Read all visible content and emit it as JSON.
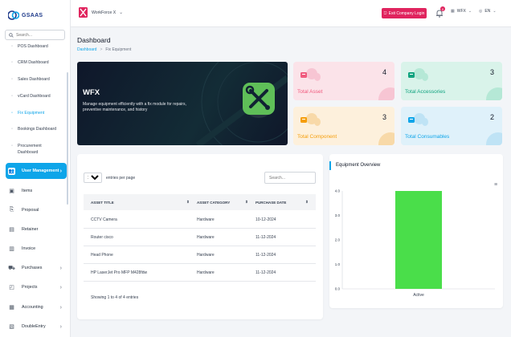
{
  "brand": {
    "name": "GSAAS",
    "accent": "#0ea5e9",
    "danger": "#e0245e"
  },
  "sidebar": {
    "search_placeholder": "Search...",
    "sub_items": [
      "POS Dashboard",
      "CRM Dashboard",
      "Sales Dashboard",
      "vCard Dashboard",
      "Fix Equipment",
      "Bookings Dashboard",
      "Procurement Dashboard"
    ],
    "active_sub": "Fix Equipment",
    "menu": [
      {
        "label": "User Management",
        "icon": "users-icon",
        "active": true,
        "chevron": true
      },
      {
        "label": "Items",
        "icon": "box-icon",
        "active": false,
        "chevron": false
      },
      {
        "label": "Proposal",
        "icon": "proposal-icon",
        "active": false,
        "chevron": false
      },
      {
        "label": "Retainer",
        "icon": "retainer-icon",
        "active": false,
        "chevron": false
      },
      {
        "label": "Invoice",
        "icon": "invoice-icon",
        "active": false,
        "chevron": false
      },
      {
        "label": "Purchases",
        "icon": "cart-icon",
        "active": false,
        "chevron": true
      },
      {
        "label": "Projects",
        "icon": "projects-icon",
        "active": false,
        "chevron": true
      },
      {
        "label": "Accounting",
        "icon": "accounting-icon",
        "active": false,
        "chevron": true
      },
      {
        "label": "DoubleEntry",
        "icon": "double-entry-icon",
        "active": false,
        "chevron": true
      }
    ]
  },
  "topbar": {
    "workspace": "WorkForce X",
    "exit_label": "Exit Company Login",
    "notification_count": "0",
    "company_selector": "WFX",
    "language": "EN"
  },
  "page": {
    "title": "Dashboard",
    "breadcrumb": [
      "Dashboard",
      "Fix Equipment"
    ]
  },
  "hero": {
    "title": "WFX",
    "description": "Manage equipment efficiently with a fix module for repairs, preventive maintenance, and history"
  },
  "stats": [
    {
      "label": "Total Asset",
      "value": "4",
      "icon": "asset-icon",
      "bg": "#fbe3e9",
      "accent": "#f05a7e",
      "blob": "#f7c5d3"
    },
    {
      "label": "Total Accessories",
      "value": "3",
      "icon": "accessories-icon",
      "bg": "#d9f3ea",
      "accent": "#10a37f",
      "blob": "#b5e8d6"
    },
    {
      "label": "Total Component",
      "value": "3",
      "icon": "component-icon",
      "bg": "#fdf0dc",
      "accent": "#f59e0b",
      "blob": "#f8d9a8"
    },
    {
      "label": "Total Consumables",
      "value": "2",
      "icon": "consumables-icon",
      "bg": "#dff1fa",
      "accent": "#0ea5e9",
      "blob": "#bfe3f5"
    }
  ],
  "table": {
    "page_size": "10",
    "entries_label": "entries per page",
    "search_placeholder": "Search...",
    "columns": [
      "ASSET TITLE",
      "ASSET CATEGORY",
      "PURCHASE DATE"
    ],
    "rows": [
      [
        "CCTV Camera",
        "Hardware",
        "10-12-2024"
      ],
      [
        "Router cisco",
        "Hardware",
        "11-12-2024"
      ],
      [
        "Head Phone",
        "Hardware",
        "11-12-2024"
      ],
      [
        "HP LaserJet Pro MFP M428fdw",
        "Hardware",
        "11-12-2024"
      ]
    ],
    "info": "Showing 1 to 4 of 4 entries"
  },
  "chart": {
    "title": "Equipment Overview"
  },
  "chart_data": {
    "type": "bar",
    "categories": [
      "Active"
    ],
    "values": [
      4
    ],
    "ylim": [
      0,
      4
    ],
    "yticks": [
      "0.0",
      "1.0",
      "2.0",
      "3.0",
      "4.0"
    ],
    "bar_color": "#4ade4a",
    "grid": false
  }
}
